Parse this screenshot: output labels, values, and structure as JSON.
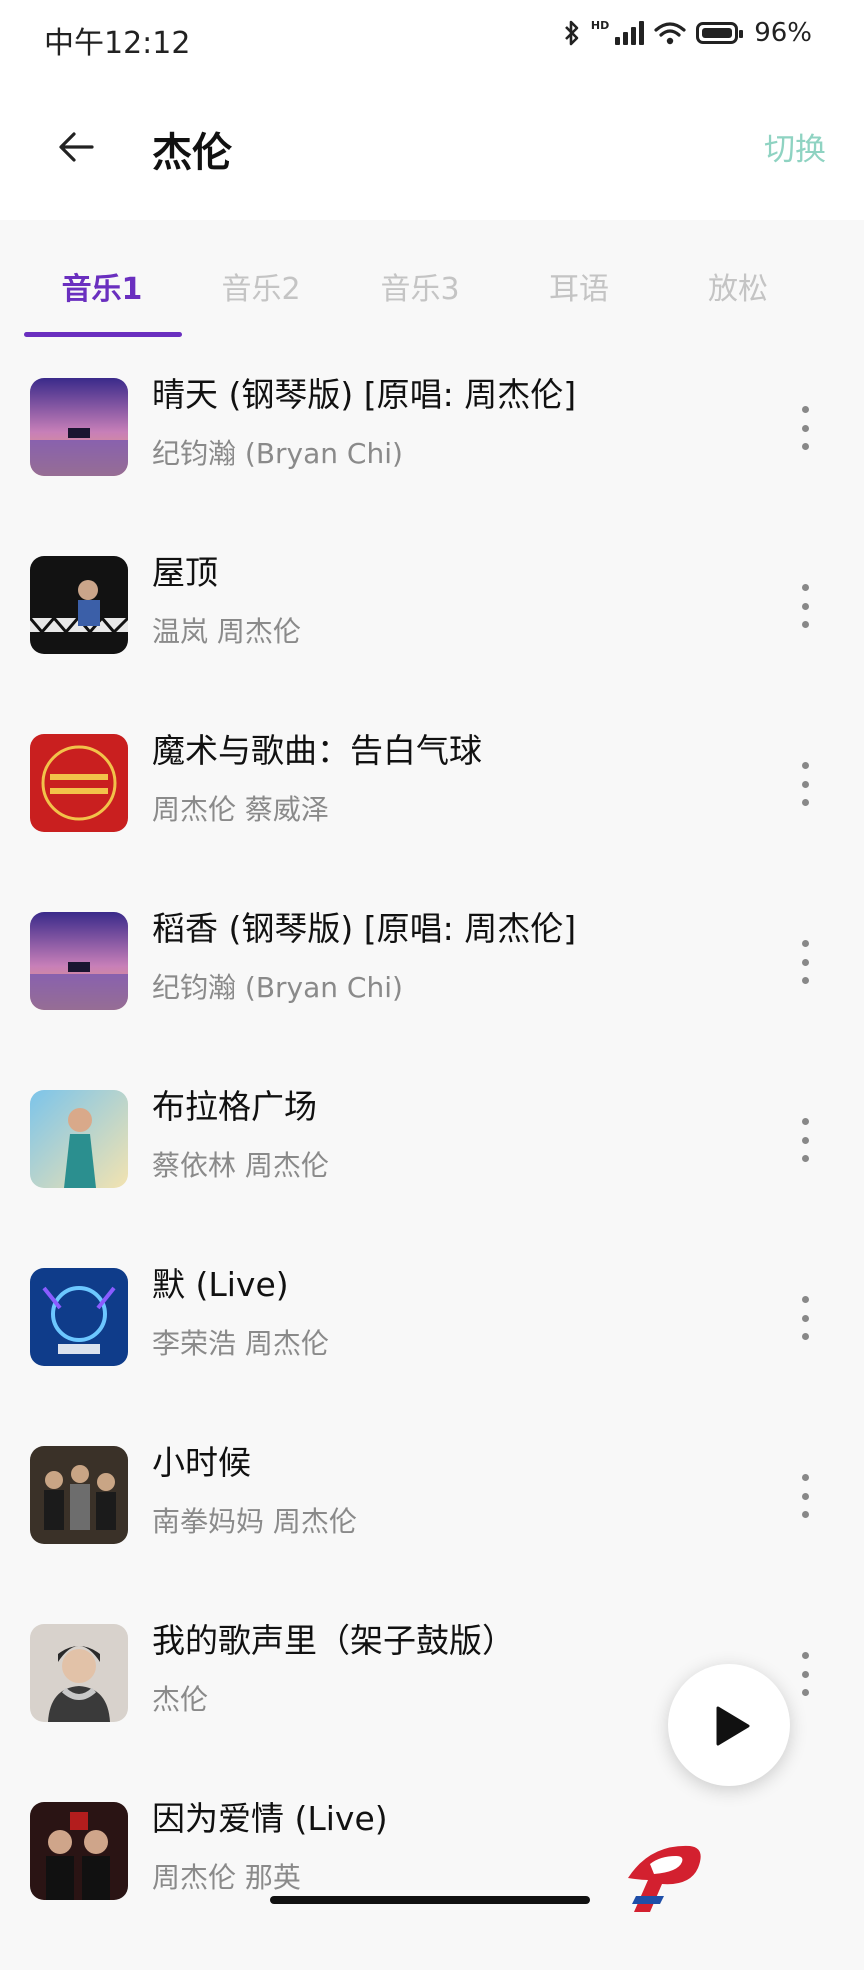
{
  "status_bar": {
    "time": "中午12:12",
    "hd": "HD",
    "battery": "96%"
  },
  "header": {
    "title": "杰伦",
    "switch_label": "切换"
  },
  "tabs": [
    {
      "label": "音乐1",
      "active": true
    },
    {
      "label": "音乐2",
      "active": false
    },
    {
      "label": "音乐3",
      "active": false
    },
    {
      "label": "耳语",
      "active": false
    },
    {
      "label": "放松",
      "active": false
    }
  ],
  "songs": [
    {
      "title": "晴天 (钢琴版) [原唱: 周杰伦]",
      "artist": "纪钧瀚 (Bryan Chi)",
      "cover_icon": "piano-sunset-cover"
    },
    {
      "title": "屋顶",
      "artist": "温岚 周杰伦",
      "cover_icon": "rooftop-cover"
    },
    {
      "title": "魔术与歌曲：告白气球",
      "artist": "周杰伦 蔡威泽",
      "cover_icon": "cctv-gala-cover"
    },
    {
      "title": "稻香 (钢琴版) [原唱: 周杰伦]",
      "artist": "纪钧瀚 (Bryan Chi)",
      "cover_icon": "piano-sunset-cover"
    },
    {
      "title": "布拉格广场",
      "artist": "蔡依林 周杰伦",
      "cover_icon": "jolin-cover"
    },
    {
      "title": "默 (Live)",
      "artist": "李荣浩 周杰伦",
      "cover_icon": "good-voice-cover"
    },
    {
      "title": "小时候",
      "artist": "南拳妈妈 周杰伦",
      "cover_icon": "band-cover"
    },
    {
      "title": "我的歌声里（架子鼓版）",
      "artist": "杰伦",
      "cover_icon": "portrait-cover"
    },
    {
      "title": "因为爱情 (Live)",
      "artist": "周杰伦 那英",
      "cover_icon": "live-cover"
    }
  ],
  "colors": {
    "accent": "#6a2fbf",
    "switch": "#8fd3c2",
    "background": "#f8f8f8"
  }
}
